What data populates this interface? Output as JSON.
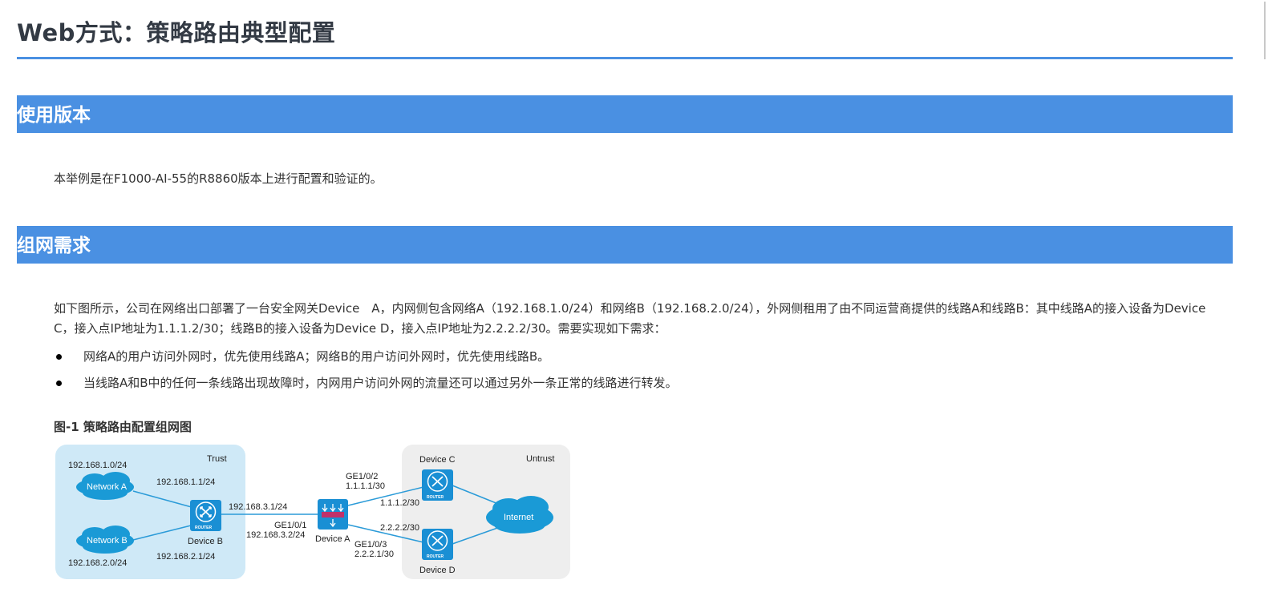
{
  "page": {
    "title": "Web方式：策略路由典型配置"
  },
  "sections": {
    "version": {
      "heading": "使用版本",
      "body": "本举例是在F1000-AI-55的R8860版本上进行配置和验证的。"
    },
    "requirements": {
      "heading": "组网需求",
      "body_line1": "如下图所示，公司在网络出口部署了一台安全网关Device　A，内网侧包含网络A（192.168.1.0/24）和网络B（192.168.2.0/24），外网侧租用了由不同运营商提供的线路A和线路B：其中线路A的接入设备为Device",
      "body_line2": "C，接入点IP地址为1.1.1.2/30；线路B的接入设备为Device D，接入点IP地址为2.2.2.2/30。需要实现如下需求：",
      "bullets": [
        "网络A的用户访问外网时，优先使用线路A；网络B的用户访问外网时，优先使用线路B。",
        "当线路A和B中的任何一条线路出现故障时，内网用户访问外网的流量还可以通过另外一条正常的线路进行转发。"
      ]
    }
  },
  "figure": {
    "caption": "图-1 策略路由配置组网图",
    "zones": {
      "trust": "Trust",
      "untrust": "Untrust"
    },
    "labels": {
      "net_a_subnet": "192.168.1.0/24",
      "net_a_gw": "192.168.1.1/24",
      "net_a": "Network A",
      "net_b": "Network B",
      "net_b_subnet": "192.168.2.0/24",
      "net_b_gw": "192.168.2.1/24",
      "device_b": "Device B",
      "b_to_a": "192.168.3.1/24",
      "a_ge101": "GE1/0/1",
      "a_ip_inside": "192.168.3.2/24",
      "device_a": "Device A",
      "a_ge102": "GE1/0/2",
      "a_ip_c": "1.1.1.1/30",
      "c_ip": "1.1.1.2/30",
      "d_ip": "2.2.2.2/30",
      "a_ge103": "GE1/0/3",
      "a_ip_d": "2.2.2.1/30",
      "device_c": "Device C",
      "device_d": "Device D",
      "internet": "Internet",
      "router_text": "ROUTER"
    },
    "colors": {
      "trust_bg": "#cfe9f7",
      "untrust_bg": "#eeeeee",
      "device_blue": "#1a8fd4",
      "link": "#2b9bd8",
      "cloud": "#1a9ad6"
    }
  }
}
